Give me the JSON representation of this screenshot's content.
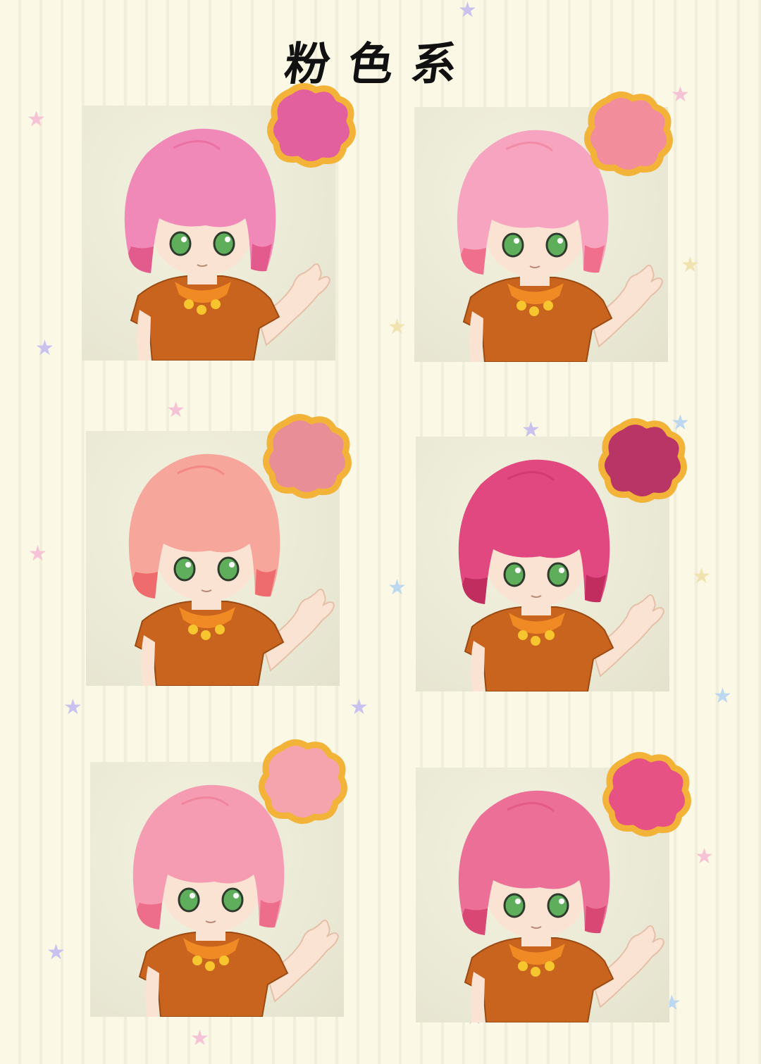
{
  "title": "粉色系",
  "colors": {
    "background": "#fbf8e6",
    "stripe": "#f1eedb",
    "swatch_outline": "#f2b338",
    "shirt": "#c8641e",
    "scarf": "#f08a24",
    "skin": "#fbe3d3",
    "eyes": "#5fae5b"
  },
  "variants": [
    {
      "hair": "#f089b8",
      "hair_dark": "#e35a8c",
      "swatch": "#e3609e"
    },
    {
      "hair": "#f7a4c0",
      "hair_dark": "#ef6f8d",
      "swatch": "#f28d9b"
    },
    {
      "hair": "#f6a69a",
      "hair_dark": "#ee6c6e",
      "swatch": "#e88e97"
    },
    {
      "hair": "#e0487f",
      "hair_dark": "#c22d60",
      "swatch": "#b83565"
    },
    {
      "hair": "#f59cb2",
      "hair_dark": "#ec6e8a",
      "swatch": "#f5a3ad"
    },
    {
      "hair": "#ec6f98",
      "hair_dark": "#d94874",
      "swatch": "#e65284"
    }
  ],
  "star_colors": [
    "#f5c2d6",
    "#c9c2ee",
    "#bcd8f0",
    "#f0e3b0"
  ]
}
